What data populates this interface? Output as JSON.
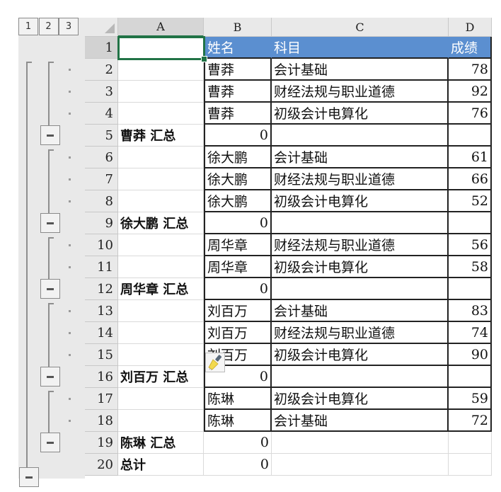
{
  "outline": {
    "levels": [
      "1",
      "2",
      "3"
    ]
  },
  "columns": [
    "A",
    "B",
    "C",
    "D"
  ],
  "selected_cell": "A1",
  "colors": {
    "header_fill": "#5b8fd0",
    "selection": "#217346"
  },
  "rows": [
    {
      "n": "1",
      "A": "",
      "B": "姓名",
      "C": "科目",
      "D": "成绩",
      "type": "header"
    },
    {
      "n": "2",
      "A": "",
      "B": "曹莽",
      "C": "会计基础",
      "D": "78",
      "type": "detail"
    },
    {
      "n": "3",
      "A": "",
      "B": "曹莽",
      "C": "财经法规与职业道德",
      "D": "92",
      "type": "detail"
    },
    {
      "n": "4",
      "A": "",
      "B": "曹莽",
      "C": "初级会计电算化",
      "D": "76",
      "type": "detail"
    },
    {
      "n": "5",
      "A": "曹莽 汇总",
      "B": "0",
      "C": "",
      "D": "",
      "type": "subtotal"
    },
    {
      "n": "6",
      "A": "",
      "B": "徐大鹏",
      "C": "会计基础",
      "D": "61",
      "type": "detail"
    },
    {
      "n": "7",
      "A": "",
      "B": "徐大鹏",
      "C": "财经法规与职业道德",
      "D": "66",
      "type": "detail"
    },
    {
      "n": "8",
      "A": "",
      "B": "徐大鹏",
      "C": "初级会计电算化",
      "D": "52",
      "type": "detail"
    },
    {
      "n": "9",
      "A": "徐大鹏 汇总",
      "B": "0",
      "C": "",
      "D": "",
      "type": "subtotal"
    },
    {
      "n": "10",
      "A": "",
      "B": "周华章",
      "C": "财经法规与职业道德",
      "D": "56",
      "type": "detail"
    },
    {
      "n": "11",
      "A": "",
      "B": "周华章",
      "C": "初级会计电算化",
      "D": "58",
      "type": "detail"
    },
    {
      "n": "12",
      "A": "周华章 汇总",
      "B": "0",
      "C": "",
      "D": "",
      "type": "subtotal"
    },
    {
      "n": "13",
      "A": "",
      "B": "刘百万",
      "C": "会计基础",
      "D": "83",
      "type": "detail"
    },
    {
      "n": "14",
      "A": "",
      "B": "刘百万",
      "C": "财经法规与职业道德",
      "D": "74",
      "type": "detail"
    },
    {
      "n": "15",
      "A": "",
      "B": "刘百万",
      "C": "初级会计电算化",
      "D": "90",
      "type": "detail"
    },
    {
      "n": "16",
      "A": "刘百万 汇总",
      "B": "0",
      "C": "",
      "D": "",
      "type": "subtotal"
    },
    {
      "n": "17",
      "A": "",
      "B": "陈琳",
      "C": "初级会计电算化",
      "D": "59",
      "type": "detail"
    },
    {
      "n": "18",
      "A": "",
      "B": "陈琳",
      "C": "会计基础",
      "D": "72",
      "type": "detail"
    },
    {
      "n": "19",
      "A": "陈琳 汇总",
      "B": "0",
      "C": "",
      "D": "",
      "type": "subtotal-outside"
    },
    {
      "n": "20",
      "A": "总计",
      "B": "0",
      "C": "",
      "D": "",
      "type": "total"
    }
  ],
  "overlay_icon": "format-painter-icon"
}
